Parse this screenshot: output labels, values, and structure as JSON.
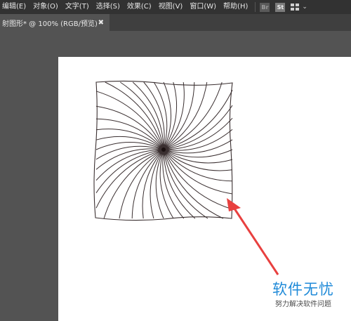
{
  "menu": {
    "items": [
      {
        "label": "编辑(E)"
      },
      {
        "label": "对象(O)"
      },
      {
        "label": "文字(T)"
      },
      {
        "label": "选择(S)"
      },
      {
        "label": "效果(C)"
      },
      {
        "label": "视图(V)"
      },
      {
        "label": "窗口(W)"
      },
      {
        "label": "帮助(H)"
      }
    ],
    "bridge_icon": "Br",
    "stock_icon": "St",
    "workspace_chevron": "⌄"
  },
  "document_tab": {
    "title": "射图形* @ 100% (RGB/预览)",
    "close": "✖"
  },
  "colors": {
    "menubar": "#323232",
    "panel": "#535353",
    "artboard": "#ffffff",
    "stroke": "#3a2f30",
    "arrow": "#e8403f",
    "watermark": "#1f8ad8"
  },
  "watermark": {
    "title": "软件无忧",
    "subtitle": "努力解决软件问题"
  }
}
